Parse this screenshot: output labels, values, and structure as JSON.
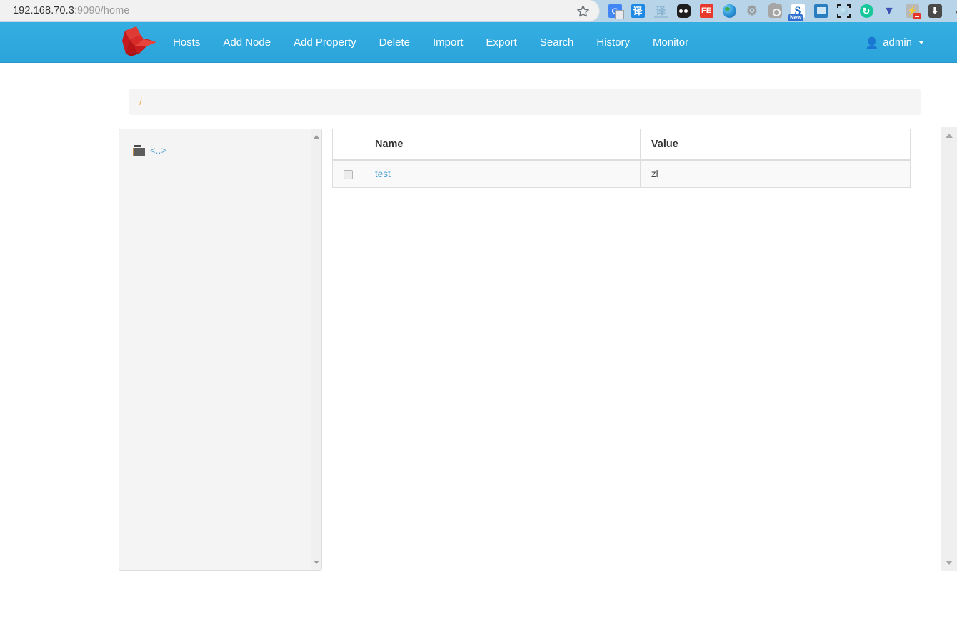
{
  "browser": {
    "url_host": "192.168.70.3",
    "url_rest": ":9090/home",
    "bookmark_icon": "star-icon",
    "extensions": [
      {
        "name": "google-translate-icon",
        "label": "G"
      },
      {
        "name": "fanyi-translate-icon",
        "label": "译"
      },
      {
        "name": "youdao-translate-icon",
        "label": "译"
      },
      {
        "name": "adblock-icon",
        "label": ""
      },
      {
        "name": "flashget-icon",
        "label": "FE"
      },
      {
        "name": "globe-browser-icon",
        "label": ""
      },
      {
        "name": "settings-gear-icon",
        "label": "⚙"
      },
      {
        "name": "screenshot-camera-icon",
        "label": ""
      },
      {
        "name": "snipaste-icon",
        "label": "S",
        "badge": "New"
      },
      {
        "name": "image-tool-icon",
        "label": ""
      },
      {
        "name": "region-capture-icon",
        "label": ""
      },
      {
        "name": "sync-refresh-icon",
        "label": "↻"
      },
      {
        "name": "vpn-shield-icon",
        "label": "V"
      },
      {
        "name": "flash-player-icon",
        "label": "⚡"
      },
      {
        "name": "download-manager-icon",
        "label": "⬇"
      },
      {
        "name": "more-extensions-icon",
        "label": "◑"
      }
    ]
  },
  "navbar": {
    "brand_icon": "zookeeper-bird-logo",
    "links": [
      {
        "label": "Hosts",
        "name": "nav-link-hosts"
      },
      {
        "label": "Add Node",
        "name": "nav-link-add-node"
      },
      {
        "label": "Add Property",
        "name": "nav-link-add-property"
      },
      {
        "label": "Delete",
        "name": "nav-link-delete"
      },
      {
        "label": "Import",
        "name": "nav-link-import"
      },
      {
        "label": "Export",
        "name": "nav-link-export"
      },
      {
        "label": "Search",
        "name": "nav-link-search"
      },
      {
        "label": "History",
        "name": "nav-link-history"
      },
      {
        "label": "Monitor",
        "name": "nav-link-monitor"
      }
    ],
    "user": {
      "name": "admin",
      "icon": "user-icon"
    }
  },
  "path_bar": {
    "current_path": "/"
  },
  "tree": {
    "nodes": [
      {
        "label": "<..>",
        "icon": "folder-icon"
      }
    ],
    "scrollbar": {
      "up": "scroll-up-arrow",
      "down": "scroll-down-arrow"
    }
  },
  "table": {
    "columns": [
      "",
      "Name",
      "Value"
    ],
    "rows": [
      {
        "checked": false,
        "name": "test",
        "value": "zl"
      }
    ]
  },
  "colors": {
    "navbar": "#2ba4da",
    "link": "#4a9fd4",
    "path_link": "#f0ad4e",
    "brand_red": "#d91f26",
    "row_bg": "#f9f9f9",
    "panel_bg": "#f4f4f4"
  }
}
